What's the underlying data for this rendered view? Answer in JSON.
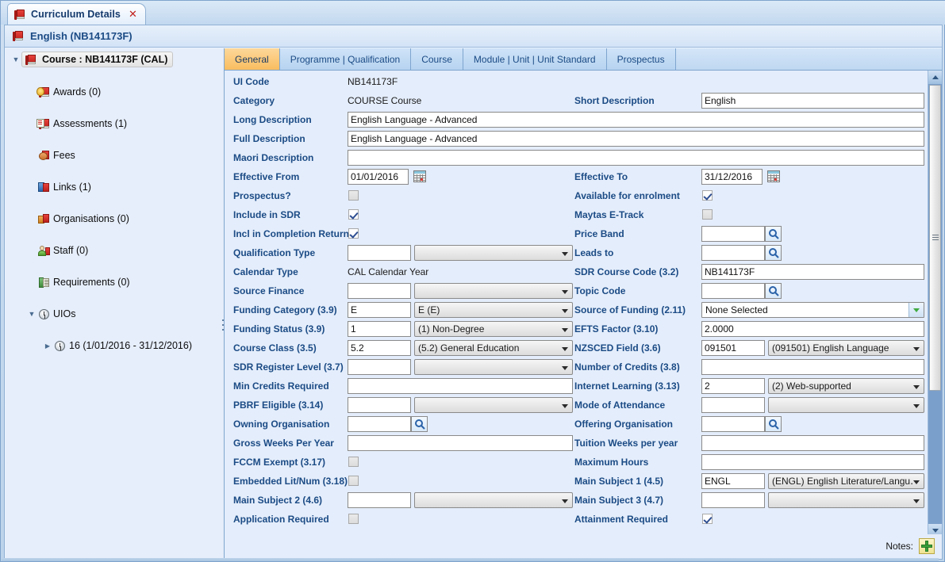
{
  "window": {
    "doc_tab_label": "Curriculum Details",
    "doc_tab_close": "✕",
    "header_title": "English (NB141173F)"
  },
  "tree": {
    "root_label": "Course : NB141173F (CAL)",
    "items": [
      {
        "label": "Awards (0)",
        "icon": "award-book-icon"
      },
      {
        "label": "Assessments (1)",
        "icon": "assessment-book-icon"
      },
      {
        "label": "Fees",
        "icon": "fees-coin-icon"
      },
      {
        "label": "Links (1)",
        "icon": "links-books-icon"
      },
      {
        "label": "Organisations (0)",
        "icon": "organisations-books-icon"
      },
      {
        "label": "Staff (0)",
        "icon": "staff-person-icon"
      },
      {
        "label": "Requirements (0)",
        "icon": "requirements-book-icon"
      }
    ],
    "uios_label": "UIOs",
    "uio_child_label": "16 (1/01/2016 - 31/12/2016)"
  },
  "tabs": [
    {
      "label": "General",
      "active": true
    },
    {
      "label": "Programme | Qualification",
      "active": false
    },
    {
      "label": "Course",
      "active": false
    },
    {
      "label": "Module | Unit | Unit Standard",
      "active": false
    },
    {
      "label": "Prospectus",
      "active": false
    }
  ],
  "form": {
    "left": {
      "ui_code_label": "UI Code",
      "ui_code_value": "NB141173F",
      "category_label": "Category",
      "category_value": "COURSE   Course",
      "long_description_label": "Long Description",
      "long_description_value": "English Language - Advanced",
      "full_description_label": "Full Description",
      "full_description_value": "English Language - Advanced",
      "maori_description_label": "Maori Description",
      "maori_description_value": "",
      "effective_from_label": "Effective From",
      "effective_from_value": "01/01/2016",
      "prospectus_label": "Prospectus?",
      "include_in_sdr_label": "Include in SDR",
      "incl_completion_return_label": "Incl in Completion Return",
      "qualification_type_label": "Qualification Type",
      "qualification_type_code": "",
      "qualification_type_desc": "",
      "calendar_type_label": "Calendar Type",
      "calendar_type_value": "CAL   Calendar Year",
      "source_finance_label": "Source Finance",
      "source_finance_code": "",
      "source_finance_desc": "",
      "funding_category_label": "Funding Category (3.9)",
      "funding_category_code": "E",
      "funding_category_desc": "E (E)",
      "funding_status_label": "Funding Status (3.9)",
      "funding_status_code": "1",
      "funding_status_desc": "(1) Non-Degree",
      "course_class_label": "Course Class (3.5)",
      "course_class_code": "5.2",
      "course_class_desc": "(5.2) General Education",
      "sdr_register_level_label": "SDR Register Level (3.7)",
      "sdr_register_level_code": "",
      "sdr_register_level_desc": "",
      "min_credits_label": "Min Credits Required",
      "min_credits_value": "",
      "pbrf_eligible_label": "PBRF Eligible (3.14)",
      "pbrf_eligible_code": "",
      "pbrf_eligible_desc": "",
      "owning_org_label": "Owning Organisation",
      "owning_org_value": "",
      "gross_weeks_label": "Gross Weeks Per Year",
      "gross_weeks_value": "",
      "fccm_exempt_label": "FCCM Exempt (3.17)",
      "embedded_lit_num_label": "Embedded Lit/Num (3.18)",
      "main_subject2_label": "Main Subject 2 (4.6)",
      "main_subject2_code": "",
      "main_subject2_desc": "",
      "application_required_label": "Application Required"
    },
    "right": {
      "short_description_label": "Short Description",
      "short_description_value": "English",
      "effective_to_label": "Effective To",
      "effective_to_value": "31/12/2016",
      "available_enrolment_label": "Available for enrolment",
      "maytas_etrack_label": "Maytas E-Track",
      "price_band_label": "Price Band",
      "price_band_value": "",
      "leads_to_label": "Leads to",
      "leads_to_value": "",
      "sdr_course_code_label": "SDR Course Code (3.2)",
      "sdr_course_code_value": "NB141173F",
      "topic_code_label": "Topic Code",
      "topic_code_value": "",
      "source_of_funding_label": "Source of Funding (2.11)",
      "source_of_funding_value": "None Selected",
      "efts_factor_label": "EFTS Factor (3.10)",
      "efts_factor_value": "2.0000",
      "nzsced_field_label": "NZSCED Field (3.6)",
      "nzsced_field_code": "091501",
      "nzsced_field_desc": "(091501) English Language",
      "number_of_credits_label": "Number of Credits (3.8)",
      "number_of_credits_value": "",
      "internet_learning_label": "Internet Learning (3.13)",
      "internet_learning_code": "2",
      "internet_learning_desc": "(2) Web-supported",
      "mode_of_attendance_label": "Mode of Attendance",
      "mode_of_attendance_code": "",
      "mode_of_attendance_desc": "",
      "offering_org_label": "Offering Organisation",
      "offering_org_value": "",
      "tuition_weeks_label": "Tuition Weeks per year",
      "tuition_weeks_value": "",
      "maximum_hours_label": "Maximum Hours",
      "maximum_hours_value": "",
      "main_subject1_label": "Main Subject 1 (4.5)",
      "main_subject1_code": "ENGL",
      "main_subject1_desc": "(ENGL) English Literature/Langu․",
      "main_subject3_label": "Main Subject 3 (4.7)",
      "main_subject3_code": "",
      "main_subject3_desc": "",
      "attainment_required_label": "Attainment Required"
    },
    "checkboxes": {
      "prospectus": false,
      "include_in_sdr": true,
      "incl_completion_return": true,
      "fccm_exempt": false,
      "embedded_lit_num": false,
      "application_required": false,
      "available_for_enrolment": true,
      "maytas_etrack": false,
      "attainment_required": true
    }
  },
  "footer": {
    "notes_label": "Notes:"
  },
  "colors": {
    "accent_tab_active": "#f9bd5f",
    "label_blue": "#1b4b85",
    "panel_bg": "#e4edfb",
    "frame_blue": "#7fa3cc",
    "book_red": "#c0201c",
    "plus_green": "#39a13a"
  }
}
